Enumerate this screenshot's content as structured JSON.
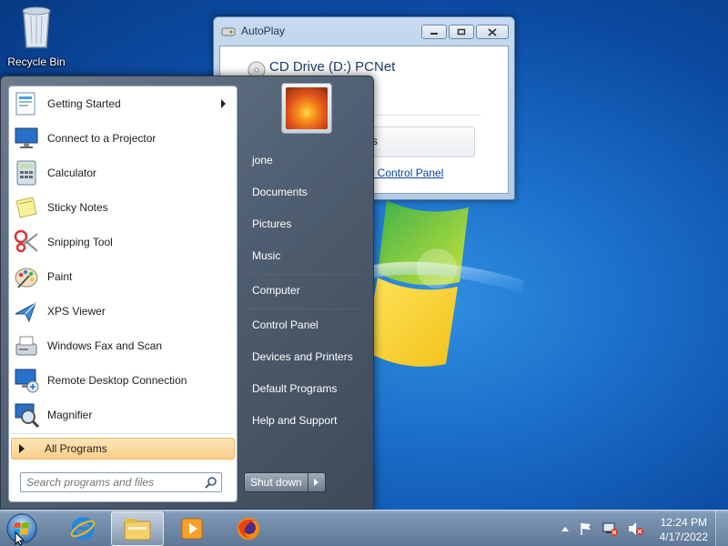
{
  "desktop": {
    "recycle_bin_label": "Recycle Bin"
  },
  "autoplay": {
    "title": "AutoPlay",
    "drive_label": "CD Drive (D:) PCNet",
    "option_text": "s",
    "control_panel_link": "in Control Panel"
  },
  "start_menu": {
    "programs": [
      {
        "label": "Getting Started",
        "icon": "getting-started-icon",
        "has_submenu": true
      },
      {
        "label": "Connect to a Projector",
        "icon": "projector-icon"
      },
      {
        "label": "Calculator",
        "icon": "calculator-icon"
      },
      {
        "label": "Sticky Notes",
        "icon": "sticky-notes-icon"
      },
      {
        "label": "Snipping Tool",
        "icon": "scissors-icon"
      },
      {
        "label": "Paint",
        "icon": "paint-palette-icon"
      },
      {
        "label": "XPS Viewer",
        "icon": "xps-viewer-icon"
      },
      {
        "label": "Windows Fax and Scan",
        "icon": "fax-icon"
      },
      {
        "label": "Remote Desktop Connection",
        "icon": "remote-desktop-icon"
      },
      {
        "label": "Magnifier",
        "icon": "magnifier-icon"
      }
    ],
    "all_programs": "All Programs",
    "search_placeholder": "Search programs and files",
    "right_links": {
      "user": "jone",
      "documents": "Documents",
      "pictures": "Pictures",
      "music": "Music",
      "computer": "Computer",
      "control_panel": "Control Panel",
      "devices_printers": "Devices and Printers",
      "default_programs": "Default Programs",
      "help_support": "Help and Support"
    },
    "shutdown": "Shut down"
  },
  "taskbar": {
    "pinned": [
      "internet-explorer-icon",
      "windows-explorer-icon",
      "media-player-icon",
      "firefox-icon"
    ],
    "time": "12:24 PM",
    "date": "4/17/2022"
  },
  "colors": {
    "desktop_blue": "#1a6cc7",
    "all_programs_highlight": "#fbcf8a",
    "start_menu_dark": "#4f5e70"
  }
}
